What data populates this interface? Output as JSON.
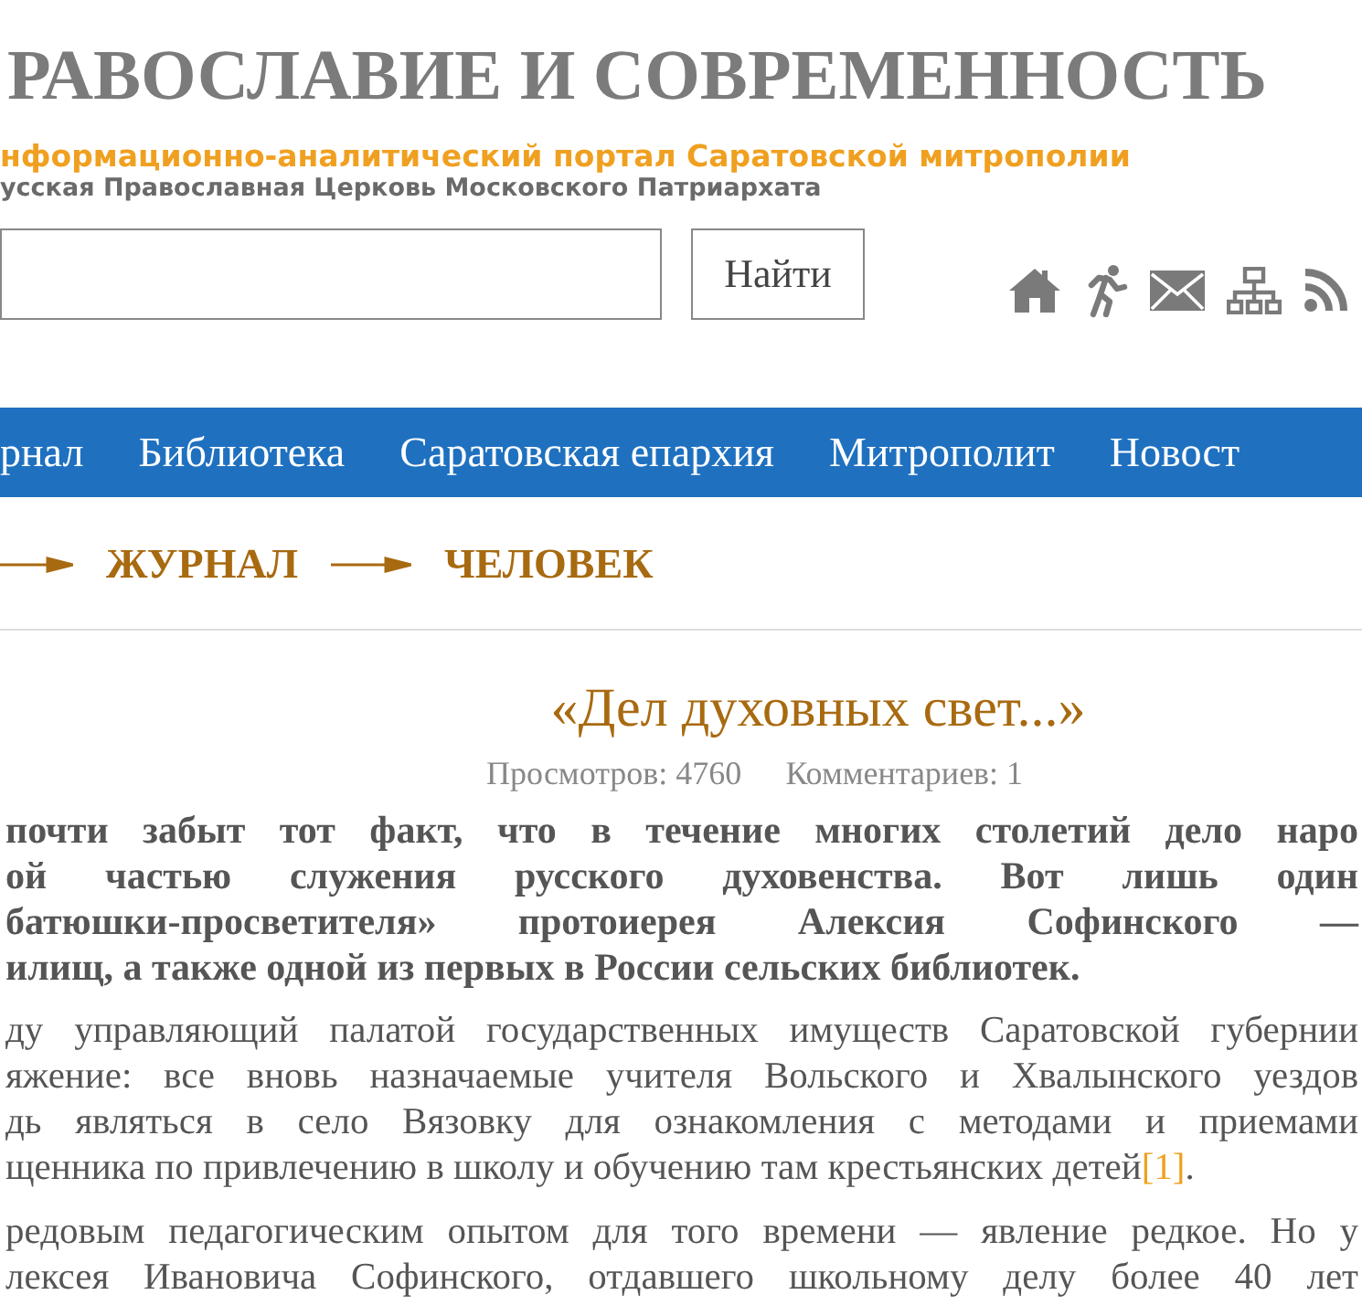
{
  "header": {
    "title": "РАВОСЛАВИЕ И СОВРЕМЕННОСТЬ",
    "tagline": "нформационно-аналитический портал Саратовской митрополии",
    "subtitle": "усская Православная Церковь Московского Патриархата"
  },
  "search": {
    "button": "Найти"
  },
  "nav": [
    {
      "label": "рнал"
    },
    {
      "label": "Библиотека"
    },
    {
      "label": "Саратовская епархия"
    },
    {
      "label": "Митрополит"
    },
    {
      "label": "Новост"
    }
  ],
  "breadcrumbs": [
    "ЖУРНАЛ",
    "ЧЕЛОВЕК"
  ],
  "article": {
    "title": "«Дел духовных свет...»",
    "views": "Просмотров: 4760",
    "comments": "Комментариев: 1",
    "lead": [
      {
        "text": "почти забыт тот факт, что в течение многих столетий дело наро",
        "justified": true
      },
      {
        "text": "ой частью служения русского духовенства. Вот лишь один",
        "justified": true
      },
      {
        "text": "батюшки-просветителя» протоиерея Алексия Софинского —",
        "justified": true
      },
      {
        "text": "илищ, а также одной из первых в России сельских библиотек.",
        "justified": false
      }
    ],
    "paragraphs": [
      {
        "lines": [
          {
            "text": "ду управляющий палатой государственных имуществ Саратовской губернии",
            "justified": true
          },
          {
            "text": "яжение: все вновь назначаемые учителя Вольского и Хвалынского уездов",
            "justified": true
          },
          {
            "text": "дь являться в село Вязовку для ознакомления с методами и приемами",
            "justified": true
          },
          {
            "text": "щенника по привлечению в школу и обучению там крестьянских детей",
            "justified": false
          }
        ],
        "footnote": "[1]",
        "end": "."
      },
      {
        "lines": [
          {
            "text": "редовым педагогическим опытом для того времени — явление редкое. Но у",
            "justified": true
          },
          {
            "text": "лексея Ивановича Софинского, отдавшего школьному делу более 40 лет",
            "justified": true
          }
        ]
      }
    ]
  }
}
